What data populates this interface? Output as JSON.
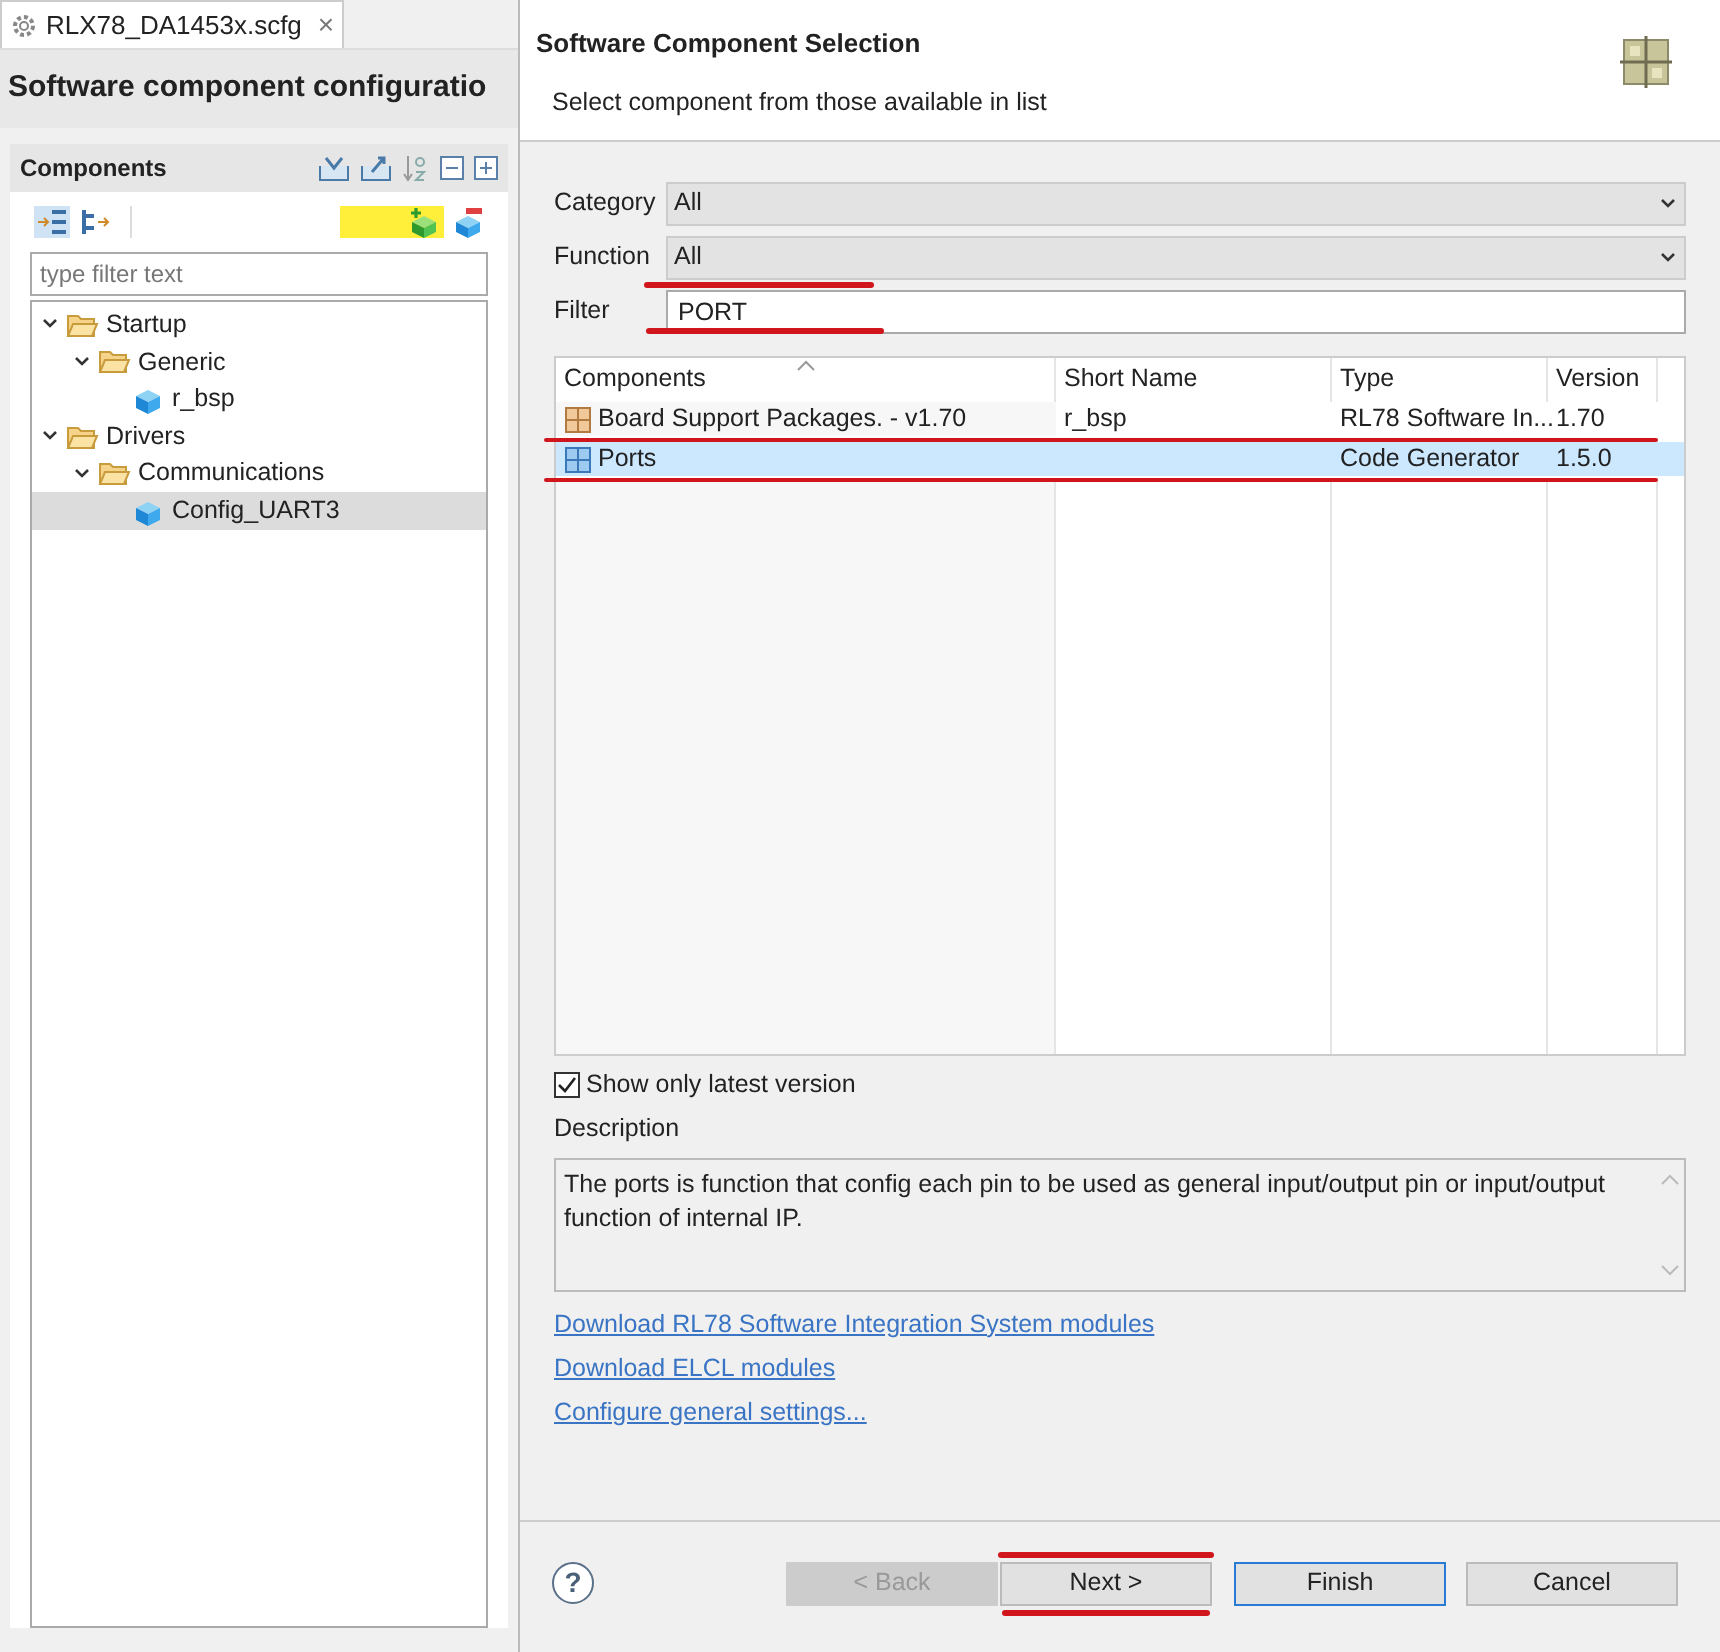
{
  "editor_tab": {
    "label": "RLX78_DA1453x.scfg",
    "close": "×"
  },
  "page_title": "Software component configuratio",
  "components_panel": {
    "title": "Components",
    "filter_placeholder": "type filter text",
    "tree": [
      {
        "label": "Startup",
        "kind": "folder",
        "expanded": true,
        "selected": false,
        "children": [
          {
            "label": "Generic",
            "kind": "folder",
            "expanded": true,
            "selected": false,
            "children": [
              {
                "label": "r_bsp",
                "kind": "component",
                "selected": false
              }
            ]
          }
        ]
      },
      {
        "label": "Drivers",
        "kind": "folder",
        "expanded": true,
        "selected": false,
        "children": [
          {
            "label": "Communications",
            "kind": "folder",
            "expanded": true,
            "selected": false,
            "children": [
              {
                "label": "Config_UART3",
                "kind": "component",
                "selected": true
              }
            ]
          }
        ]
      }
    ]
  },
  "dialog": {
    "title": "Software Component Selection",
    "subtitle": "Select component from those available in list",
    "fields": [
      {
        "label": "Category",
        "kind": "dropdown",
        "value": "All"
      },
      {
        "label": "Function",
        "kind": "dropdown",
        "value": "All"
      },
      {
        "label": "Filter",
        "kind": "text",
        "value": "PORT"
      }
    ],
    "table": {
      "columns": [
        "Components",
        "Short Name",
        "Type",
        "Version"
      ],
      "rows": [
        {
          "kind": "bsp",
          "selected": false,
          "cells": [
            "Board Support Packages. - v1.70",
            "r_bsp",
            "RL78 Software In...",
            "1.70"
          ]
        },
        {
          "kind": "generator",
          "selected": true,
          "cells": [
            "Ports",
            "",
            "Code Generator",
            "1.5.0"
          ]
        }
      ]
    },
    "show_latest": {
      "label": "Show only latest version",
      "checked": true
    },
    "description_label": "Description",
    "description": "The ports is function that config each pin to be used as general input/output pin or input/output function of internal IP.",
    "links": [
      "Download RL78 Software Integration System modules",
      "Download ELCL modules",
      "Configure general settings..."
    ],
    "help": "?",
    "buttons": [
      {
        "label": "< Back",
        "disabled": true,
        "default": false
      },
      {
        "label": "Next >",
        "disabled": false,
        "default": false
      },
      {
        "label": "Finish",
        "disabled": false,
        "default": true
      },
      {
        "label": "Cancel",
        "disabled": false,
        "default": false
      }
    ]
  }
}
